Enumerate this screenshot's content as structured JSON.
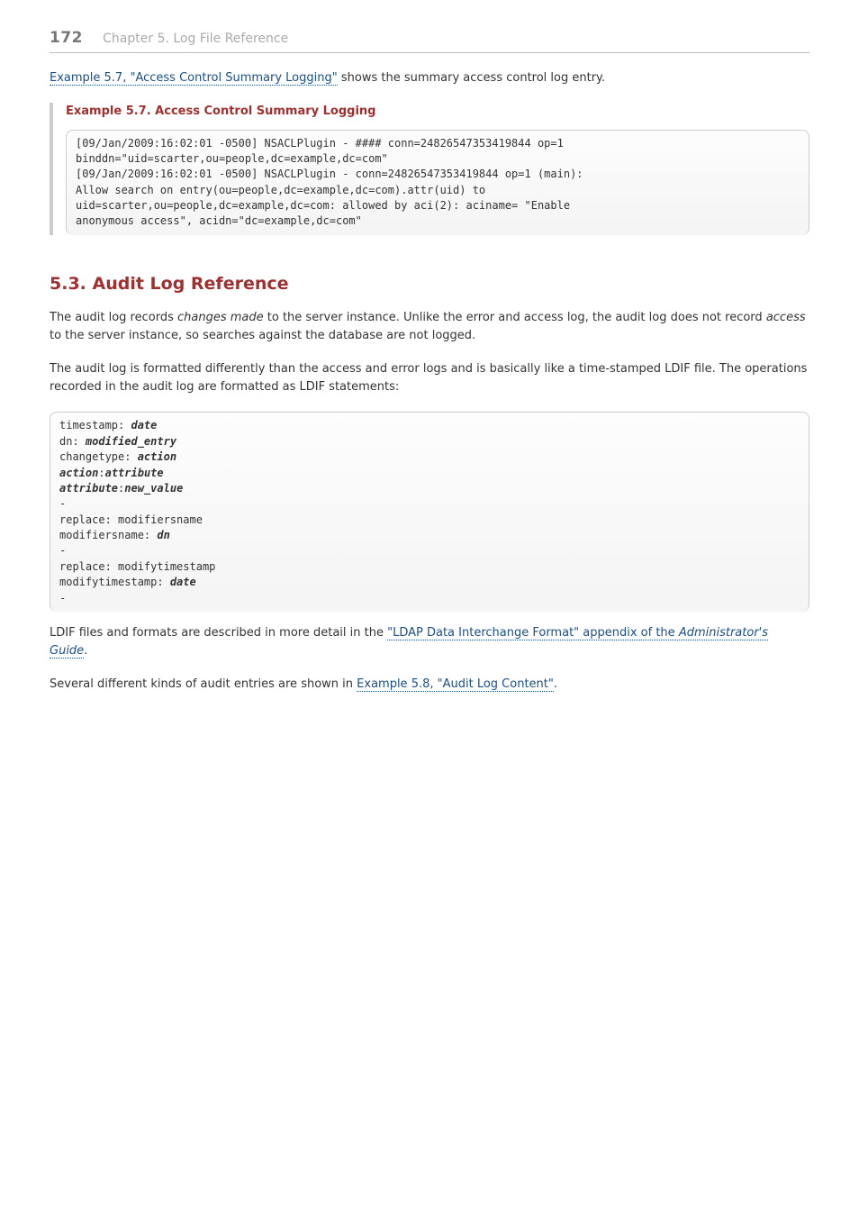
{
  "header": {
    "page_number": "172",
    "chapter": "Chapter 5. Log File Reference"
  },
  "intro": {
    "link_example57": "Example 5.7, \"Access Control Summary Logging\"",
    "after_link": " shows the summary access control log entry."
  },
  "example57": {
    "title": "Example 5.7. Access Control Summary Logging",
    "code": "[09/Jan/2009:16:02:01 -0500] NSACLPlugin - #### conn=24826547353419844 op=1\nbinddn=\"uid=scarter,ou=people,dc=example,dc=com\"\n[09/Jan/2009:16:02:01 -0500] NSACLPlugin - conn=24826547353419844 op=1 (main):\nAllow search on entry(ou=people,dc=example,dc=com).attr(uid) to\nuid=scarter,ou=people,dc=example,dc=com: allowed by aci(2): aciname= \"Enable\nanonymous access\", acidn=\"dc=example,dc=com\""
  },
  "section": {
    "title": "5.3. Audit Log Reference",
    "p1_a": "The audit log records ",
    "p1_b_italic": "changes made",
    "p1_c": " to the server instance. Unlike the error and access log, the audit log does not record ",
    "p1_d_italic": "access",
    "p1_e": " to the server instance, so searches against the database are not logged.",
    "p2": "The audit log is formatted differently than the access and error logs and is basically like a time-stamped LDIF file. The operations recorded in the audit log are formatted as LDIF statements:",
    "p3_a": "LDIF files and formats are described in more detail in the ",
    "p3_link_a": "\"LDAP Data Interchange Format\" appendix of the ",
    "p3_link_b_italic": "Administrator's Guide",
    "p3_c": ".",
    "p4_a": "Several different kinds of audit entries are shown in ",
    "p4_link": "Example 5.8, \"Audit Log Content\"",
    "p4_c": "."
  },
  "ldif": {
    "l1a": "timestamp: ",
    "l1b": "date",
    "l2a": "dn: ",
    "l2b": "modified_entry",
    "l3a": "changetype: ",
    "l3b": "action",
    "l4a": "action",
    "l4b": ":",
    "l4c": "attribute",
    "l5a": "attribute",
    "l5b": ":",
    "l5c": "new_value",
    "dash1": "-",
    "l6": "replace: modifiersname",
    "l7a": "modifiersname: ",
    "l7b": "dn",
    "dash2": "-",
    "l8": "replace: modifytimestamp",
    "l9a": "modifytimestamp: ",
    "l9b": "date",
    "dash3": "-"
  }
}
